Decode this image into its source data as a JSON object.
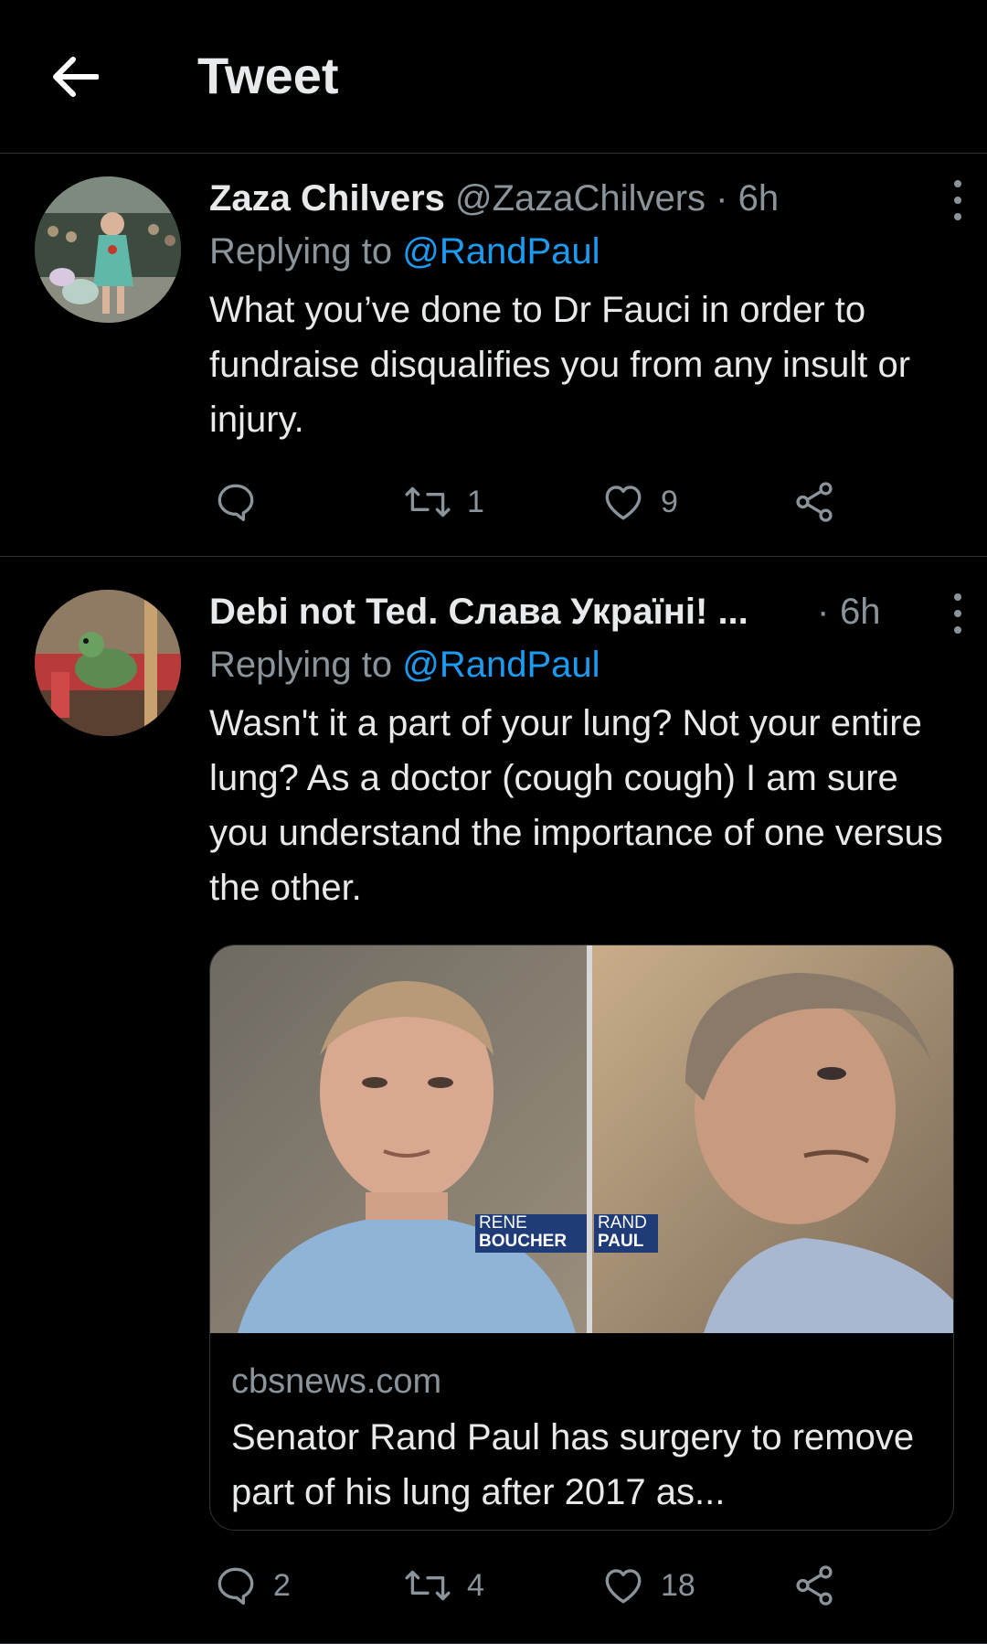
{
  "header": {
    "title": "Tweet",
    "back_icon": "arrow-left-icon"
  },
  "tweets": [
    {
      "name": "Zaza Chilvers",
      "handle": "@ZazaChilvers",
      "sep": "·",
      "time": "6h",
      "replying_prefix": "Replying to",
      "replying_to": "@RandPaul",
      "text": "What you’ve done to Dr Fauci in order to fundraise disqualifies you from any insult or injury.",
      "reply_count": "",
      "retweet_count": "1",
      "like_count": "9"
    },
    {
      "name": "Debi not Ted. Слава Україні! ...",
      "handle": "",
      "sep": "·",
      "time": "6h",
      "replying_prefix": "Replying to",
      "replying_to": "@RandPaul",
      "text": "Wasn't it a part of your lung? Not your entire lung? As a doctor (cough cough) I am sure you understand the importance of one versus the other.",
      "reply_count": "2",
      "retweet_count": "4",
      "like_count": "18",
      "card": {
        "domain": "cbsnews.com",
        "title": "Senator Rand Paul has surgery to remove part of his lung after 2017 as...",
        "left_caption_1": "RENE",
        "left_caption_2": "BOUCHER",
        "right_caption_1": "RAND",
        "right_caption_2": "PAUL"
      }
    }
  ],
  "colors": {
    "background": "#000000",
    "text": "#e7e9ea",
    "muted": "#8b949a",
    "link": "#1d9bf0",
    "divider": "#2f3336"
  }
}
